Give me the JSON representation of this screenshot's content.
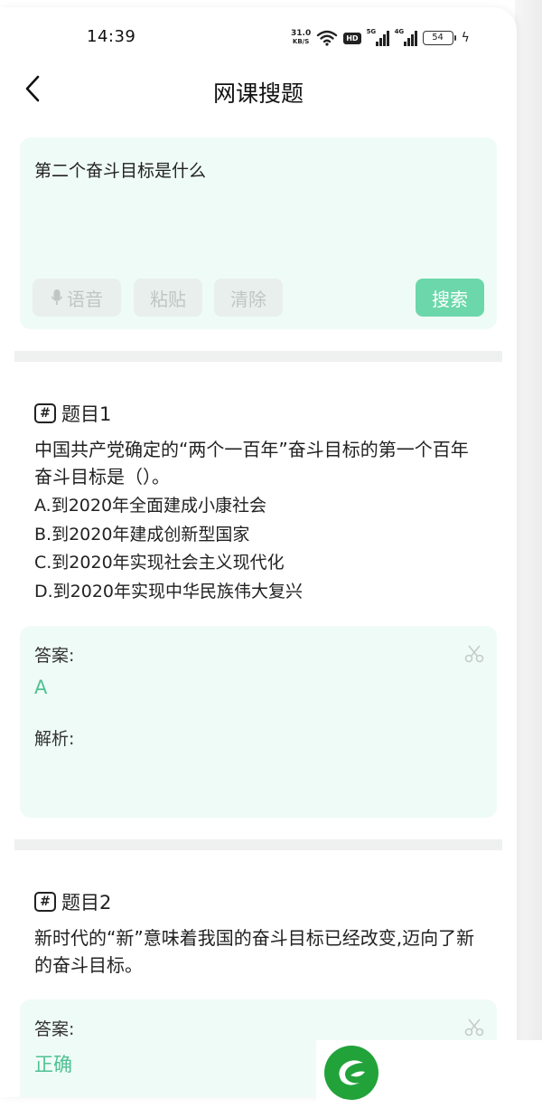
{
  "status_bar": {
    "time": "14:39",
    "net_speed_value": "31.0",
    "net_speed_unit": "KB/S",
    "hd_badge": "HD",
    "sim1_label": "5G",
    "sim2_label": "4G",
    "battery": "54"
  },
  "nav": {
    "title": "网课搜题",
    "back_icon": "chevron-left-icon"
  },
  "search": {
    "query": "第二个奋斗目标是什么",
    "voice_label": "语音",
    "paste_label": "粘贴",
    "clear_label": "清除",
    "search_label": "搜索"
  },
  "questions": [
    {
      "header": "题目1",
      "stem": "中国共产党确定的“两个一百年”奋斗目标的第一个百年奋斗目标是（）。",
      "options": [
        "A.到2020年全面建成小康社会",
        "B.到2020年建成创新型国家",
        "C.到2020年实现社会主义现代化",
        "D.到2020年实现中华民族伟大复兴"
      ],
      "answer_label": "答案:",
      "answer": "A",
      "analysis_label": "解析:"
    },
    {
      "header": "题目2",
      "stem": "新时代的“新”意味着我国的奋斗目标已经改变,迈向了新的奋斗目标。",
      "answer_label": "答案:",
      "answer": "正确"
    }
  ],
  "colors": {
    "accent": "#6bd7aa",
    "answer_text": "#4fc193",
    "card_bg": "#effbf6",
    "logo_green": "#22a33a"
  }
}
